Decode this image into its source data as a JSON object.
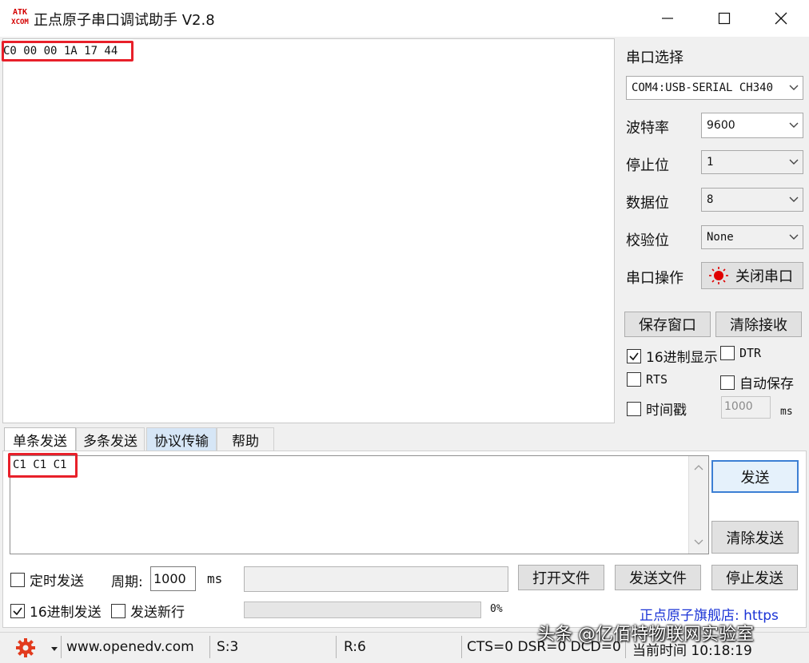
{
  "window": {
    "title": "正点原子串口调试助手 V2.8",
    "logo_top": "ATK",
    "logo_bottom": "XCOM",
    "minimize_label": "—",
    "maximize_label": "☐",
    "close_label": "✕"
  },
  "receive": {
    "text": "C0 00 00 1A 17 44"
  },
  "settings": {
    "port_select_label": "串口选择",
    "port_value": "COM4:USB-SERIAL CH340",
    "baud_label": "波特率",
    "baud_value": "9600",
    "stopbits_label": "停止位",
    "stopbits_value": "1",
    "databits_label": "数据位",
    "databits_value": "8",
    "parity_label": "校验位",
    "parity_value": "None",
    "port_op_label": "串口操作",
    "close_port_label": "关闭串口",
    "save_window_label": "保存窗口",
    "clear_receive_label": "清除接收",
    "hex_display_label": "16进制显示",
    "hex_display_checked": true,
    "dtr_label": "DTR",
    "rts_label": "RTS",
    "auto_save_label": "自动保存",
    "timestamp_label": "时间戳",
    "timestamp_value": "1000",
    "timestamp_unit": "ms"
  },
  "tabs": [
    {
      "label": "单条发送"
    },
    {
      "label": "多条发送"
    },
    {
      "label": "协议传输"
    },
    {
      "label": "帮助"
    }
  ],
  "send": {
    "text": "C1 C1 C1",
    "send_button": "发送",
    "clear_send_button": "清除发送",
    "timed_send_label": "定时发送",
    "period_label": "周期:",
    "period_value": "1000",
    "period_unit": "ms",
    "open_file_button": "打开文件",
    "send_file_button": "发送文件",
    "stop_send_button": "停止发送",
    "hex_send_label": "16进制发送",
    "hex_send_checked": true,
    "newline_label": "发送新行",
    "progress_percent": "0%",
    "progress_value": 0,
    "store_text": "正点原子旗舰店: https"
  },
  "status": {
    "website": "www.openedv.com",
    "sent": "S:3",
    "received": "R:6",
    "line_status": "CTS=0 DSR=0 DCD=0",
    "time": "当前时间 10:18:19"
  },
  "watermark": "头条 @亿佰特物联网实验室",
  "colors": {
    "highlight": "#e8202a",
    "store_link": "#1a33d6",
    "led": "#e00000"
  }
}
